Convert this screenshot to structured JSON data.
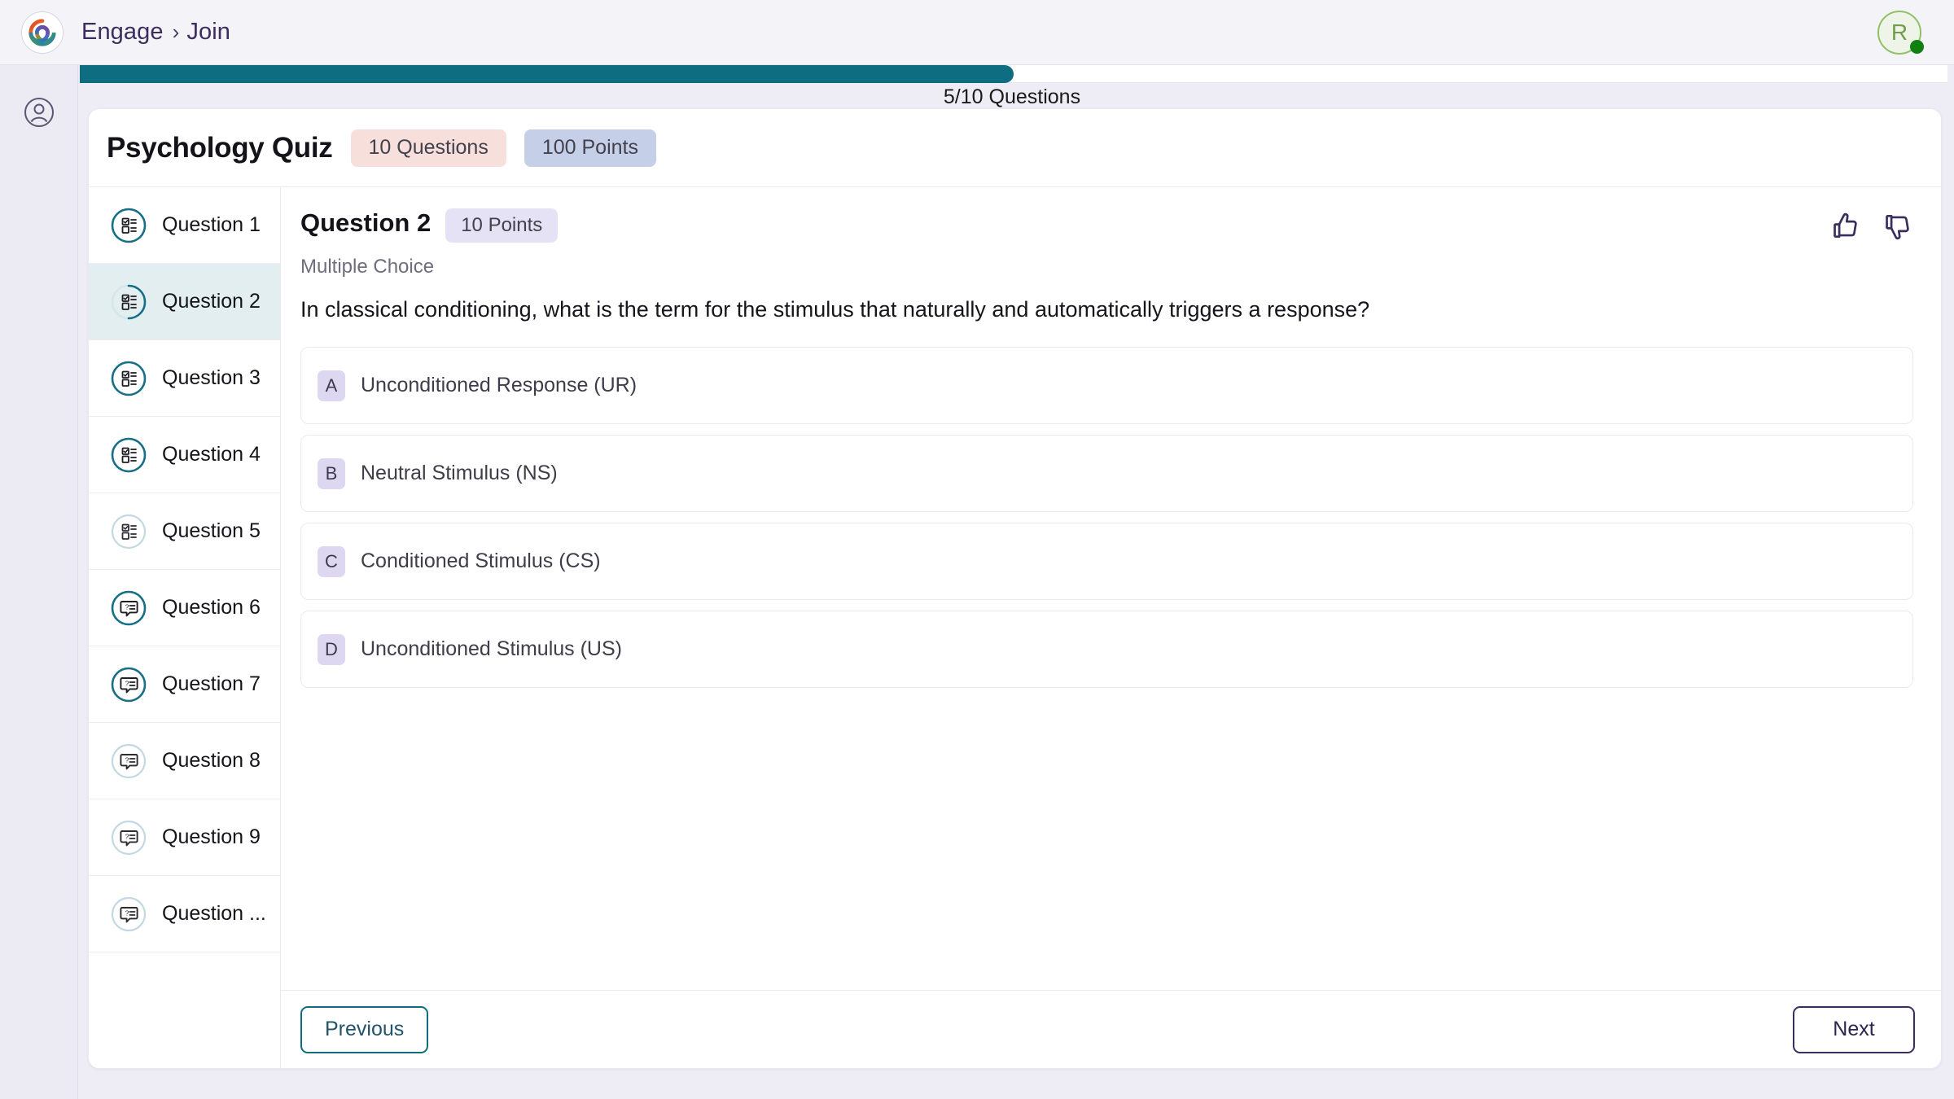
{
  "topbar": {
    "logo_icon": "engage-spiral-logo",
    "breadcrumb": {
      "root": "Engage",
      "separator": "›",
      "current": "Join"
    },
    "avatar": {
      "initial": "R",
      "status": "online",
      "status_color": "#118011",
      "ring_color": "#92c06a"
    }
  },
  "rail": {
    "profile_icon": "user-circle-icon"
  },
  "progress": {
    "label": "5/10 Questions",
    "current": 5,
    "total": 10,
    "percent": 50,
    "fill_color": "#0e6d81"
  },
  "quiz": {
    "title": "Psychology Quiz",
    "questions_pill": "10 Questions",
    "points_pill": "100 Points",
    "questions_pill_color": "#f7dfdc",
    "points_pill_color": "#c6cfe8"
  },
  "question_list": [
    {
      "label": "Question 1",
      "icon": "multiple-choice-icon",
      "state": "answered",
      "active": false
    },
    {
      "label": "Question 2",
      "icon": "multiple-choice-icon",
      "state": "current",
      "active": true
    },
    {
      "label": "Question 3",
      "icon": "multiple-choice-icon",
      "state": "answered",
      "active": false
    },
    {
      "label": "Question 4",
      "icon": "multiple-choice-icon",
      "state": "answered",
      "active": false
    },
    {
      "label": "Question 5",
      "icon": "multiple-choice-icon",
      "state": "unanswered",
      "active": false
    },
    {
      "label": "Question 6",
      "icon": "short-answer-icon",
      "state": "answered",
      "active": false
    },
    {
      "label": "Question 7",
      "icon": "short-answer-icon",
      "state": "answered",
      "active": false
    },
    {
      "label": "Question 8",
      "icon": "short-answer-icon",
      "state": "unanswered",
      "active": false
    },
    {
      "label": "Question 9",
      "icon": "short-answer-icon",
      "state": "unanswered",
      "active": false
    },
    {
      "label": "Question ...",
      "icon": "short-answer-icon",
      "state": "unanswered",
      "active": false
    }
  ],
  "current_question": {
    "heading": "Question 2",
    "points_pill": "10 Points",
    "type_label": "Multiple Choice",
    "text": "In classical conditioning, what is the term for the stimulus that naturally and automatically triggers a response?",
    "thumbs_up_icon": "thumbs-up-icon",
    "thumbs_down_icon": "thumbs-down-icon",
    "options": [
      {
        "key": "A",
        "text": "Unconditioned Response (UR)"
      },
      {
        "key": "B",
        "text": "Neutral Stimulus (NS)"
      },
      {
        "key": "C",
        "text": "Conditioned Stimulus (CS)"
      },
      {
        "key": "D",
        "text": "Unconditioned Stimulus (US)"
      }
    ]
  },
  "footer": {
    "previous_label": "Previous",
    "next_label": "Next",
    "previous_border_color": "#0e6d81",
    "next_border_color": "#3b2d5e"
  }
}
